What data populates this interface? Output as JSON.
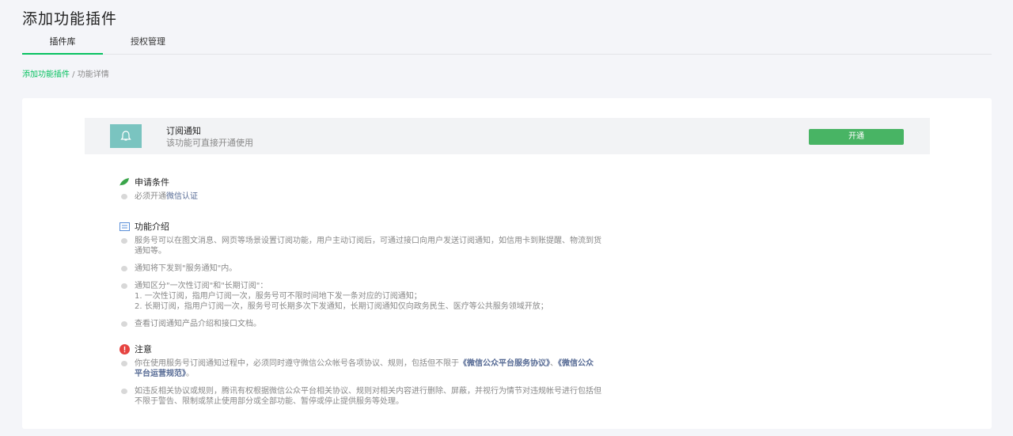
{
  "header": {
    "title": "添加功能插件",
    "tabs": [
      {
        "label": "插件库",
        "active": true
      },
      {
        "label": "授权管理",
        "active": false
      }
    ],
    "breadcrumb": {
      "link": "添加功能插件",
      "separator": " / ",
      "current": "功能详情"
    }
  },
  "plugin": {
    "icon": "bell-icon",
    "name": "订阅通知",
    "desc": "该功能可直接开通使用",
    "open_label": "开通"
  },
  "conditions": {
    "title": "申请条件",
    "icon": "leaf-icon",
    "item_prefix": "必须开通",
    "item_link": "微信认证"
  },
  "intro": {
    "title": "功能介绍",
    "icon": "document-icon",
    "item1_line1": "服务号可以在图文消息、网页等场景设置订阅功能，用户主动订阅后，可通过接口向用户发送订阅通知，如信用卡到账提醒、物流到货",
    "item1_line2": "通知等。",
    "item2": "通知将下发到\"服务通知\"内。",
    "item3_line1": "通知区分\"一次性订阅\"和\"长期订阅\"：",
    "item3_line2": "1. 一次性订阅，指用户订阅一次，服务号可不限时间地下发一条对应的订阅通知；",
    "item3_line3": "2. 长期订阅，指用户订阅一次，服务号可长期多次下发通知，长期订阅通知仅向政务民生、医疗等公共服务领域开放；",
    "item4": "查看订阅通知产品介绍和接口文档。"
  },
  "notice": {
    "title": "注意",
    "icon": "warning-icon",
    "item1_prefix": "你在使用服务号订阅通知过程中，必须同时遵守微信公众帐号各项协议、规则，包括但不限于",
    "item1_link1": "《微信公众平台服务协议》",
    "item1_sep": "、",
    "item1_link2a": "《微信公众",
    "item1_link2b": "平台运营规范》",
    "item1_suffix": "。",
    "item2_line1": "如违反相关协议或规则，腾讯有权根据微信公众平台相关协议、规则对相关内容进行删除、屏蔽，并视行为情节对违规帐号进行包括但",
    "item2_line2": "不限于警告、限制或禁止使用部分或全部功能、暂停或停止提供服务等处理。"
  },
  "colors": {
    "accent": "#07c160",
    "button": "#48b464",
    "link": "#576b95",
    "warning": "#e64340",
    "icon_bg": "#7ac4c0"
  }
}
